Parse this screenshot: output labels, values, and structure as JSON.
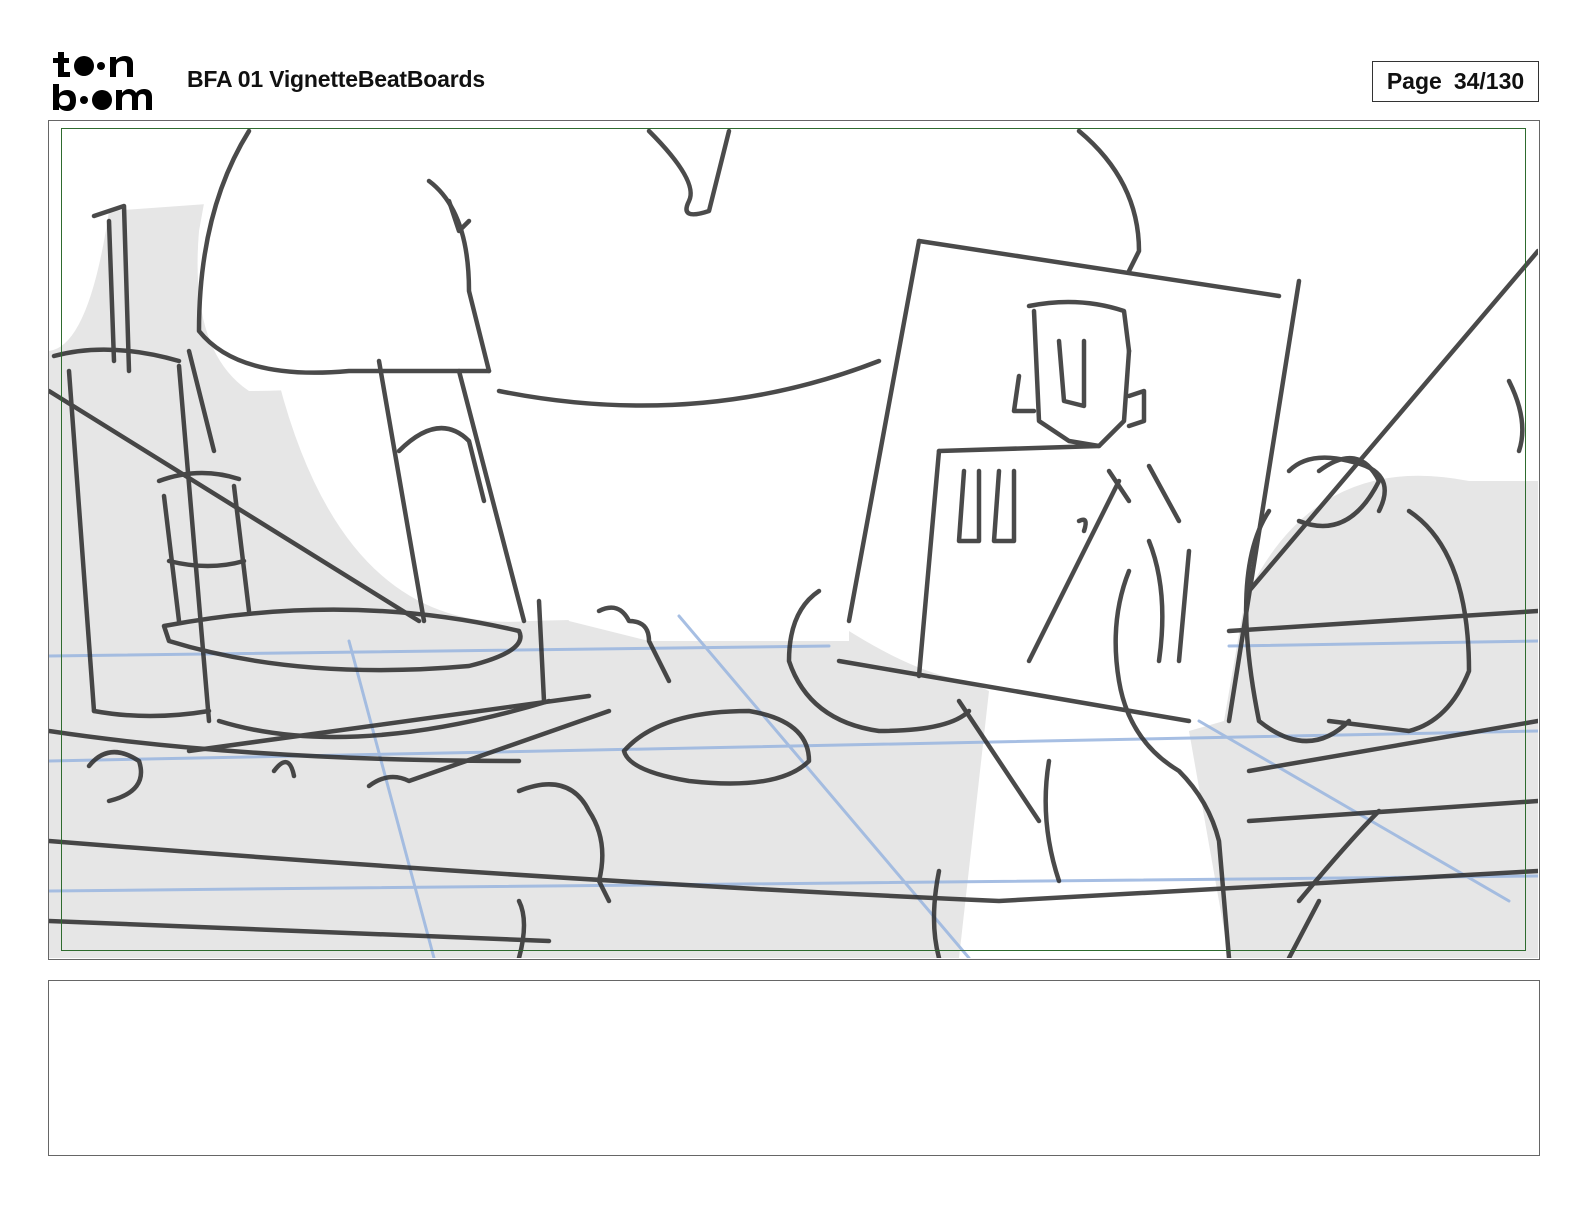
{
  "header": {
    "logo_text": "toonboom",
    "project_title": "BFA 01 VignetteBeatBoards",
    "page_label": "Page",
    "page_number": "34/130"
  },
  "panel": {
    "sketch_icon": "storyboard-sketch-image",
    "colors": {
      "safe_frame": "#2e6b2e",
      "sketch_line": "#2b2b2b",
      "shadow_fill": "#e6e6e6",
      "guide_line": "#9db8e0"
    }
  },
  "notes": {
    "text": ""
  }
}
